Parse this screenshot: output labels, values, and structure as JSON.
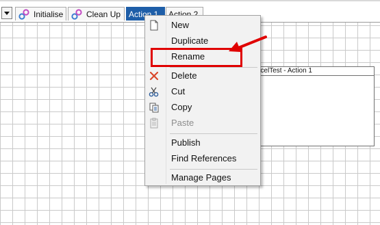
{
  "tabs": [
    {
      "label": "Initialise",
      "icon": "gears-icon",
      "active": false
    },
    {
      "label": "Clean Up",
      "icon": "gears-icon",
      "active": false
    },
    {
      "label": "Action 1",
      "active": true
    },
    {
      "label": "Action 2",
      "active": false
    }
  ],
  "canvas": {
    "page_box_title": "celTest - Action 1"
  },
  "context_menu": {
    "items": [
      {
        "label": "New",
        "icon": "new-page-icon",
        "enabled": true
      },
      {
        "label": "Duplicate",
        "icon": "",
        "enabled": true
      },
      {
        "label": "Rename",
        "icon": "",
        "enabled": true,
        "highlighted": true
      },
      {
        "label": "Delete",
        "icon": "delete-x-icon",
        "enabled": true
      },
      {
        "label": "Cut",
        "icon": "scissors-icon",
        "enabled": true
      },
      {
        "label": "Copy",
        "icon": "copy-icon",
        "enabled": true
      },
      {
        "label": "Paste",
        "icon": "paste-icon",
        "enabled": false
      },
      {
        "label": "Publish",
        "icon": "",
        "enabled": true
      },
      {
        "label": "Find References",
        "icon": "",
        "enabled": true
      },
      {
        "label": "Manage Pages",
        "icon": "",
        "enabled": true
      }
    ]
  },
  "colors": {
    "active_tab": "#1e5ea8",
    "highlight": "#e00000"
  }
}
